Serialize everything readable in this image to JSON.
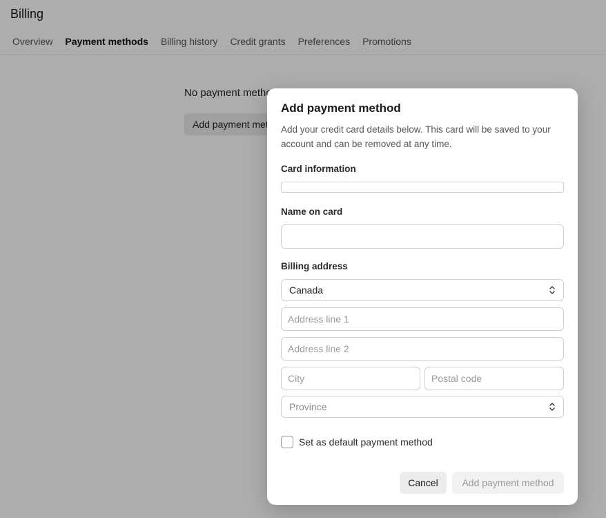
{
  "page": {
    "title": "Billing",
    "tabs": [
      {
        "label": "Overview",
        "active": false
      },
      {
        "label": "Payment methods",
        "active": true
      },
      {
        "label": "Billing history",
        "active": false
      },
      {
        "label": "Credit grants",
        "active": false
      },
      {
        "label": "Preferences",
        "active": false
      },
      {
        "label": "Promotions",
        "active": false
      }
    ],
    "empty_text": "No payment methods",
    "add_button_label": "Add payment method"
  },
  "modal": {
    "title": "Add payment method",
    "description": "Add your credit card details below. This card will be saved to your account and can be removed at any time.",
    "card_info_label": "Card information",
    "name_label": "Name on card",
    "name_value": "",
    "billing_label": "Billing address",
    "country_value": "Canada",
    "address1_placeholder": "Address line 1",
    "address2_placeholder": "Address line 2",
    "city_placeholder": "City",
    "postal_placeholder": "Postal code",
    "province_placeholder": "Province",
    "default_checkbox_label": "Set as default payment method",
    "cancel_label": "Cancel",
    "submit_label": "Add payment method"
  }
}
